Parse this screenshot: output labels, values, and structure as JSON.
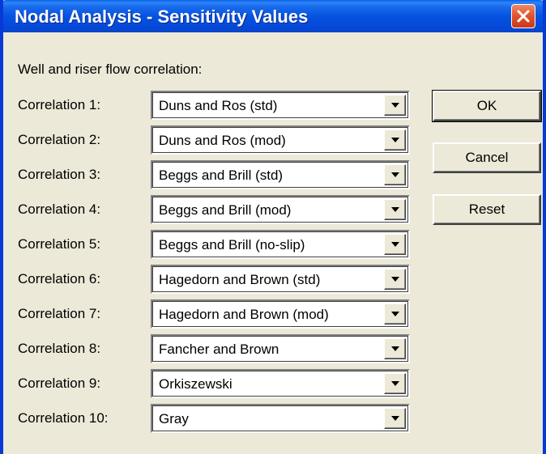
{
  "window": {
    "title": "Nodal Analysis - Sensitivity Values"
  },
  "group_label": "Well and riser flow correlation:",
  "rows": [
    {
      "label": "Correlation 1:",
      "value": "Duns and Ros (std)"
    },
    {
      "label": "Correlation 2:",
      "value": "Duns and Ros (mod)"
    },
    {
      "label": "Correlation 3:",
      "value": "Beggs and Brill (std)"
    },
    {
      "label": "Correlation 4:",
      "value": "Beggs and Brill (mod)"
    },
    {
      "label": "Correlation 5:",
      "value": "Beggs and Brill (no-slip)"
    },
    {
      "label": "Correlation 6:",
      "value": "Hagedorn and Brown (std)"
    },
    {
      "label": "Correlation 7:",
      "value": "Hagedorn and Brown (mod)"
    },
    {
      "label": "Correlation 8:",
      "value": "Fancher and Brown"
    },
    {
      "label": "Correlation 9:",
      "value": "Orkiszewski"
    },
    {
      "label": "Correlation 10:",
      "value": "Gray"
    }
  ],
  "buttons": {
    "ok": "OK",
    "cancel": "Cancel",
    "reset": "Reset"
  },
  "icons": {
    "close": "close-icon",
    "dropdown": "chevron-down-icon"
  },
  "colors": {
    "titlebar": "#0553e0",
    "close": "#e1512a",
    "face": "#ece9d8"
  }
}
